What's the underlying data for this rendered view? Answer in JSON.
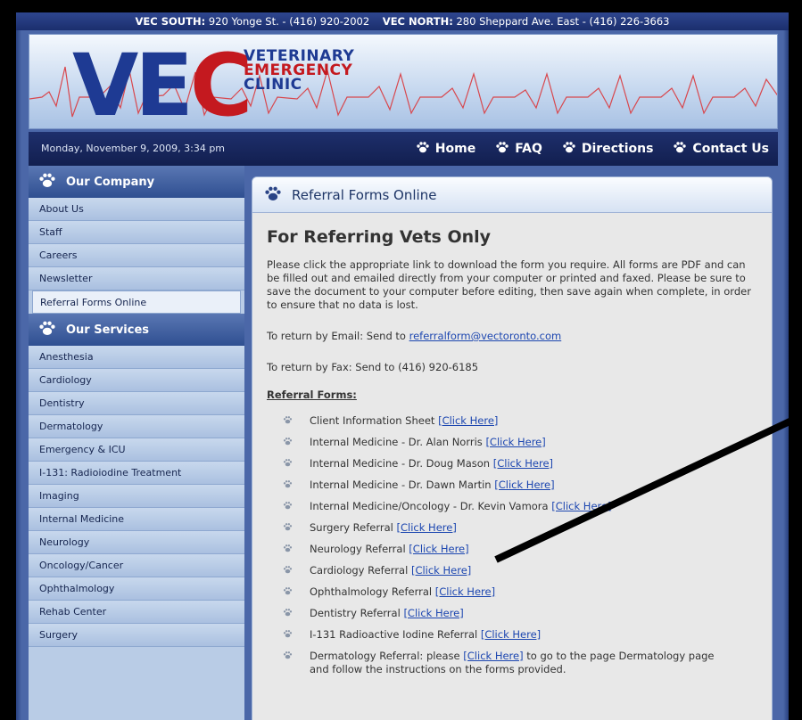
{
  "topbar": {
    "south_label": "VEC SOUTH:",
    "south_text": "920 Yonge St. - (416) 920-2002",
    "north_label": "VEC NORTH:",
    "north_text": "280 Sheppard Ave. East - (416) 226-3663"
  },
  "banner": {
    "logo_letters": [
      "V",
      "E",
      "C"
    ],
    "logo_words": [
      "VETERINARY",
      "EMERGENCY",
      "CLINIC"
    ]
  },
  "navbar": {
    "date": "Monday, November 9, 2009, 3:34 pm",
    "links": [
      {
        "label": "Home",
        "icon": "paw-icon"
      },
      {
        "label": "FAQ",
        "icon": "paw-icon"
      },
      {
        "label": "Directions",
        "icon": "paw-icon"
      },
      {
        "label": "Contact Us",
        "icon": "paw-icon"
      }
    ]
  },
  "sidebar": {
    "company_heading": "Our Company",
    "company_items": [
      "About Us",
      "Staff",
      "Careers",
      "Newsletter",
      "Referral Forms Online"
    ],
    "active_item": "Referral Forms Online",
    "services_heading": "Our Services",
    "services_items": [
      "Anesthesia",
      "Cardiology",
      "Dentistry",
      "Dermatology",
      "Emergency & ICU",
      "I-131: Radioiodine Treatment",
      "Imaging",
      "Internal Medicine",
      "Neurology",
      "Oncology/Cancer",
      "Ophthalmology",
      "Rehab Center",
      "Surgery"
    ]
  },
  "content": {
    "header": "Referral Forms Online",
    "title": "For Referring Vets Only",
    "intro": "Please click the appropriate link to download the form you require. All forms are PDF and can be filled out and emailed directly from your computer or printed and faxed. Please be sure to save the document to your computer before editing, then save again when complete, in order to ensure that no data is lost.",
    "email_prefix": "To return by Email: Send to ",
    "email": "referralform@vectoronto.com",
    "fax": "To return by Fax: Send to (416) 920-6185",
    "forms_heading": "Referral Forms:",
    "forms": [
      {
        "label": "Client Information Sheet ",
        "link": "[Click Here]",
        "suffix": ""
      },
      {
        "label": "Internal Medicine - Dr. Alan Norris ",
        "link": "[Click Here]",
        "suffix": ""
      },
      {
        "label": "Internal Medicine - Dr. Doug Mason ",
        "link": "[Click Here]",
        "suffix": ""
      },
      {
        "label": "Internal Medicine - Dr. Dawn Martin ",
        "link": "[Click Here]",
        "suffix": ""
      },
      {
        "label": "Internal Medicine/Oncology - Dr. Kevin Vamora ",
        "link": "[Click Here]",
        "suffix": ""
      },
      {
        "label": "Surgery Referral ",
        "link": "[Click Here]",
        "suffix": ""
      },
      {
        "label": "Neurology Referral ",
        "link": "[Click Here]",
        "suffix": ""
      },
      {
        "label": "Cardiology Referral ",
        "link": "[Click Here]",
        "suffix": ""
      },
      {
        "label": "Ophthalmology Referral ",
        "link": "[Click Here]",
        "suffix": ""
      },
      {
        "label": "Dentistry Referral  ",
        "link": "[Click Here]",
        "suffix": ""
      },
      {
        "label": "I-131 Radioactive Iodine Referral ",
        "link": "[Click Here]",
        "suffix": ""
      },
      {
        "label": "Dermatology Referral: please ",
        "link": "[Click Here]",
        "suffix": " to go to the page Dermatology page and follow the instructions on the forms provided."
      }
    ]
  },
  "colors": {
    "brand_blue": "#1e3a93",
    "brand_red": "#c4191f",
    "nav_bg": "#1e2f6c",
    "link": "#1c46b0"
  }
}
